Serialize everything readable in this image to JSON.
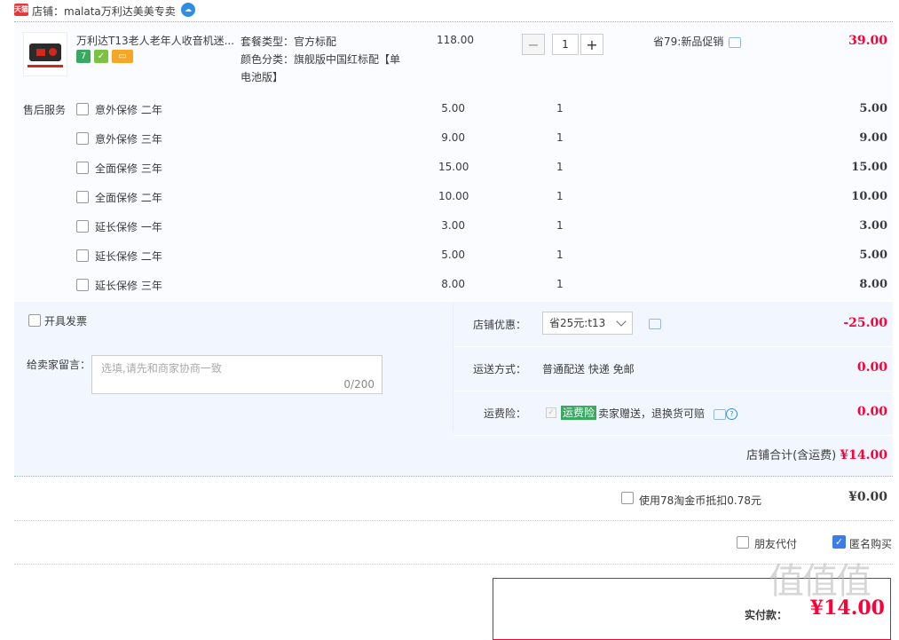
{
  "shop": {
    "label": "店铺：malata万利达美美专卖",
    "tmall_icon": "天猫"
  },
  "item": {
    "title": "万利达T13老人老年人收音机迷...",
    "package": "套餐类型：官方标配",
    "color_line1": "颜色分类：旗舰版中国红标配【单",
    "color_line2": "电池版】",
    "price": "118.00",
    "qty": "1",
    "promo": "省79:新品促销",
    "subtotal": "39.00"
  },
  "services": {
    "label": "售后服务",
    "items": [
      {
        "name": "意外保修 二年",
        "price": "5.00",
        "qty": "1",
        "total": "5.00"
      },
      {
        "name": "意外保修 三年",
        "price": "9.00",
        "qty": "1",
        "total": "9.00"
      },
      {
        "name": "全面保修 三年",
        "price": "15.00",
        "qty": "1",
        "total": "15.00"
      },
      {
        "name": "全面保修 二年",
        "price": "10.00",
        "qty": "1",
        "total": "10.00"
      },
      {
        "name": "延长保修 一年",
        "price": "3.00",
        "qty": "1",
        "total": "3.00"
      },
      {
        "name": "延长保修 二年",
        "price": "5.00",
        "qty": "1",
        "total": "5.00"
      },
      {
        "name": "延长保修 三年",
        "price": "8.00",
        "qty": "1",
        "total": "8.00"
      }
    ]
  },
  "invoice": {
    "label": "开具发票"
  },
  "message": {
    "label": "给卖家留言：",
    "placeholder": "选填,请先和商家协商一致",
    "count": "0/200"
  },
  "discount": {
    "label": "店铺优惠：",
    "selected": "省25元:t13",
    "value": "-25.00"
  },
  "shipping": {
    "label": "运送方式：",
    "method": "普通配送 快递 免邮",
    "value": "0.00"
  },
  "insurance": {
    "label": "运费险：",
    "badge": "运费险",
    "text": "卖家赠送，退换货可赔",
    "value": "0.00"
  },
  "shop_total": {
    "label": "店铺合计(含运费)",
    "value": "¥14.00"
  },
  "coins": {
    "label": "使用78淘金币抵扣0.78元",
    "value": "¥0.00"
  },
  "options": {
    "friend_pay": "朋友代付",
    "anonymous": "匿名购买"
  },
  "pay": {
    "label": "实付款：",
    "value": "¥14.00"
  },
  "watermark": "值值值",
  "colors": {
    "price_red": "#ff0036",
    "border_blue": "#80b2ff",
    "accent_blue": "#3d7de8"
  }
}
